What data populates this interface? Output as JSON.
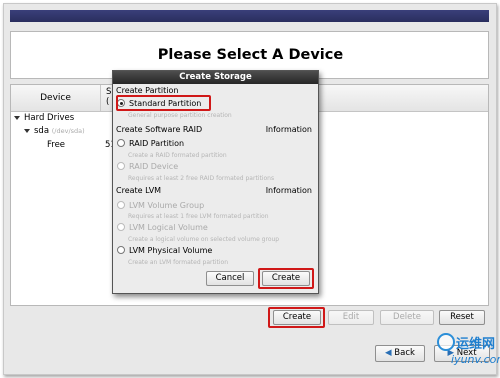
{
  "header": {
    "title": "Please Select A Device"
  },
  "table": {
    "col_device": "Device",
    "col_size_line1": "S",
    "col_size_line2": "(",
    "rows": [
      {
        "label": "Hard Drives",
        "sub": ""
      },
      {
        "label": "sda",
        "sub": "(/dev/sda)"
      },
      {
        "label": "Free",
        "size": "51"
      }
    ]
  },
  "dialog": {
    "title": "Create Storage",
    "sections": {
      "partition": "Create Partition",
      "raid": "Create Software RAID",
      "raid_info": "Information",
      "lvm": "Create LVM",
      "lvm_info": "Information"
    },
    "options": [
      {
        "label": "Standard Partition",
        "desc": "General purpose partition creation",
        "selected": true,
        "enabled": true
      },
      {
        "label": "RAID Partition",
        "desc": "Create a RAID formated partition",
        "selected": false,
        "enabled": true
      },
      {
        "label": "RAID Device",
        "desc": "Requires at least 2 free RAID formated partitions",
        "selected": false,
        "enabled": false
      },
      {
        "label": "LVM Volume Group",
        "desc": "Requires at least 1 free LVM formated partition",
        "selected": false,
        "enabled": false
      },
      {
        "label": "LVM Logical Volume",
        "desc": "Create a logical volume on selected volume group",
        "selected": false,
        "enabled": false
      },
      {
        "label": "LVM Physical Volume",
        "desc": "Create an LVM formated partition",
        "selected": false,
        "enabled": true
      }
    ],
    "cancel_label": "Cancel",
    "create_label": "Create"
  },
  "toolbar": {
    "create_label": "Create",
    "edit_label": "Edit",
    "delete_label": "Delete",
    "reset_label": "Reset"
  },
  "nav": {
    "back_label": "Back",
    "next_label": "Next"
  },
  "watermark": {
    "cn": "运维网",
    "url": "iyunv.com"
  },
  "colors": {
    "highlight": "#d01818",
    "title_bar": "#2a2e5e"
  }
}
